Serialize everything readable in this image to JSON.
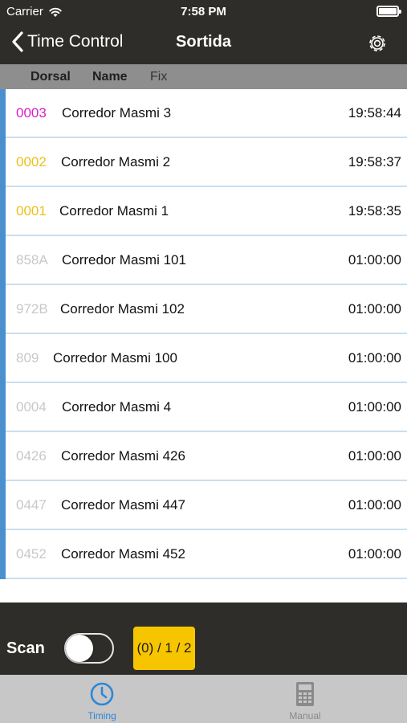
{
  "status_bar": {
    "carrier": "Carrier",
    "time": "7:58 PM"
  },
  "nav": {
    "back_label": "Time Control",
    "title": "Sortida"
  },
  "columns": {
    "dorsal": "Dorsal",
    "name": "Name",
    "fix": "Fix"
  },
  "runners": [
    {
      "dorsal": "0003",
      "name": "Corredor Masmi 3",
      "time": "19:58:44",
      "dorsal_color": "#d61fc6"
    },
    {
      "dorsal": "0002",
      "name": "Corredor Masmi 2",
      "time": "19:58:37",
      "dorsal_color": "#e8c21a"
    },
    {
      "dorsal": "0001",
      "name": "Corredor Masmi 1",
      "time": "19:58:35",
      "dorsal_color": "#e8c21a"
    },
    {
      "dorsal": "858A",
      "name": "Corredor Masmi 101",
      "time": "01:00:00",
      "dorsal_color": "#c8c8c8"
    },
    {
      "dorsal": "972B",
      "name": "Corredor Masmi 102",
      "time": "01:00:00",
      "dorsal_color": "#c8c8c8"
    },
    {
      "dorsal": "809",
      "name": "Corredor Masmi 100",
      "time": "01:00:00",
      "dorsal_color": "#c8c8c8"
    },
    {
      "dorsal": "0004",
      "name": "Corredor Masmi 4",
      "time": "01:00:00",
      "dorsal_color": "#c8c8c8"
    },
    {
      "dorsal": "0426",
      "name": "Corredor Masmi 426",
      "time": "01:00:00",
      "dorsal_color": "#c8c8c8"
    },
    {
      "dorsal": "0447",
      "name": "Corredor Masmi 447",
      "time": "01:00:00",
      "dorsal_color": "#c8c8c8"
    },
    {
      "dorsal": "0452",
      "name": "Corredor Masmi 452",
      "time": "01:00:00",
      "dorsal_color": "#c8c8c8"
    }
  ],
  "bottom": {
    "scan_label": "Scan",
    "scan_on": false,
    "counter": "(0) / 1 / 2"
  },
  "tabs": [
    {
      "label": "Timing",
      "icon": "clock-icon",
      "selected": true
    },
    {
      "label": "Manual",
      "icon": "calculator-icon",
      "selected": false
    }
  ],
  "colors": {
    "accent": "#2f86d6",
    "row_bar": "#4a90cf",
    "counter_bg": "#f6c500",
    "header_bg": "#2f2d2a"
  }
}
